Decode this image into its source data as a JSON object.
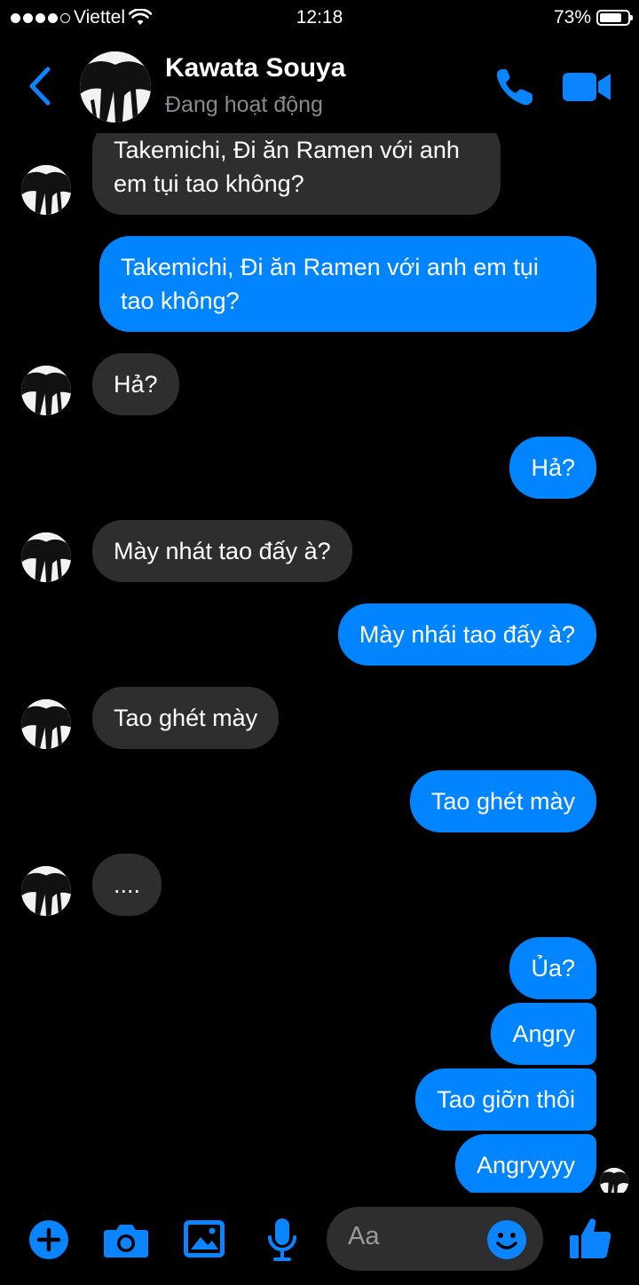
{
  "status_bar": {
    "carrier": "Viettel",
    "time": "12:18",
    "battery": "73%"
  },
  "header": {
    "name": "Kawata Souya",
    "status": "Đang hoạt động"
  },
  "messages": [
    {
      "from": "them",
      "text": "Takemichi, Đi ăn Ramen với anh em tụi tao không?"
    },
    {
      "from": "me",
      "text": "Takemichi, Đi ăn Ramen với anh em tụi tao không?"
    },
    {
      "from": "them",
      "text": "Hả?"
    },
    {
      "from": "me",
      "text": "Hả?"
    },
    {
      "from": "them",
      "text": "Mày nhát tao đấy à?"
    },
    {
      "from": "me",
      "text": "Mày nhái tao đấy à?"
    },
    {
      "from": "them",
      "text": "Tao ghét mày"
    },
    {
      "from": "me",
      "text": "Tao ghét mày"
    },
    {
      "from": "them",
      "text": "...."
    },
    {
      "from": "me",
      "text": "Ủa?"
    },
    {
      "from": "me",
      "text": "Angry"
    },
    {
      "from": "me",
      "text": "Tao giỡn thôi"
    },
    {
      "from": "me",
      "text": "Angryyyy"
    }
  ],
  "composer": {
    "placeholder": "Aa",
    "icons": [
      "plus-icon",
      "camera-icon",
      "image-icon",
      "microphone-icon",
      "emoji-icon",
      "thumbs-up-icon"
    ]
  },
  "colors": {
    "accent": "#0084ff",
    "received_bubble": "#2e2e2e",
    "background": "#000000"
  }
}
